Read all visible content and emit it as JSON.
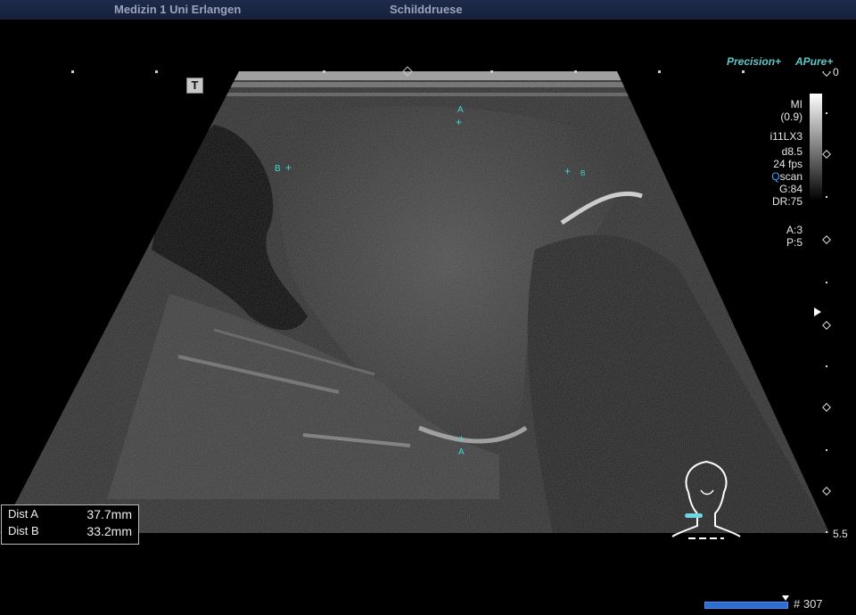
{
  "header": {
    "institution": "Medizin 1 Uni Erlangen",
    "preset": "Schilddruese"
  },
  "brand": {
    "precision": "Precision+",
    "apure": "APure+"
  },
  "params": {
    "mi_label": "MI",
    "mi_value": "(0.9)",
    "probe": "i11LX3",
    "depth": "d8.5",
    "fps": "24 fps",
    "qscan_q": "Q",
    "qscan_rest": "scan",
    "gain": "G:84",
    "dr": "DR:75",
    "a": "A:3",
    "p": "P:5"
  },
  "depth_scale": {
    "top": "0",
    "bottom": "5.5"
  },
  "measurements": [
    {
      "label": "Dist A",
      "value": "37.7mm"
    },
    {
      "label": "Dist B",
      "value": "33.2mm"
    }
  ],
  "markers": {
    "a": "A",
    "b": "B"
  },
  "t_button": "T",
  "frame": {
    "number": "# 307"
  },
  "colors": {
    "accent": "#3dd8d0",
    "brand": "#5fc7c7",
    "header": "#1e2a4a"
  }
}
